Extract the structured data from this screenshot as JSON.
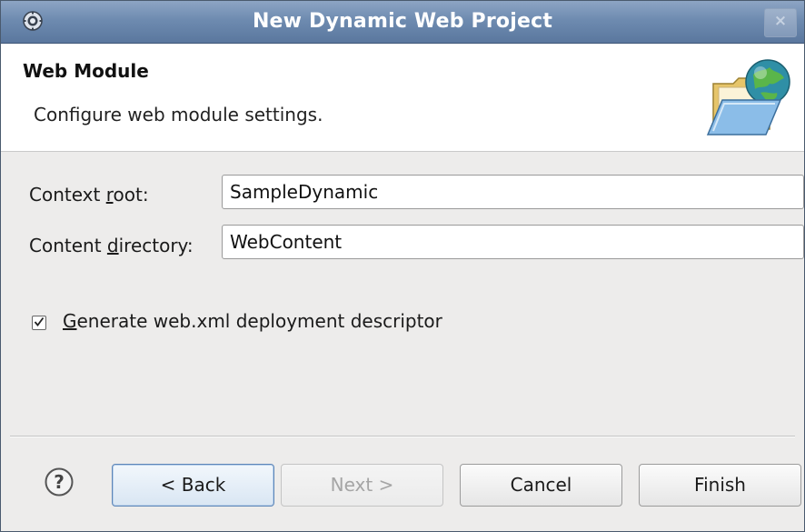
{
  "window": {
    "title": "New Dynamic Web Project",
    "close_glyph": "×"
  },
  "banner": {
    "heading": "Web Module",
    "description": "Configure web module settings.",
    "icon": "folder-globe-icon"
  },
  "form": {
    "context_root": {
      "label_pre": "Context ",
      "label_mnemonic": "r",
      "label_post": "oot:",
      "value": "SampleDynamic"
    },
    "content_directory": {
      "label_pre": "Content ",
      "label_mnemonic": "d",
      "label_post": "irectory:",
      "value": "WebContent"
    },
    "generate_descriptor": {
      "checked": true,
      "label_mnemonic": "G",
      "label_post": "enerate web.xml deployment descriptor"
    }
  },
  "buttons": {
    "back": "< Back",
    "next": "Next >",
    "cancel": "Cancel",
    "finish": "Finish",
    "help_glyph": "?"
  }
}
